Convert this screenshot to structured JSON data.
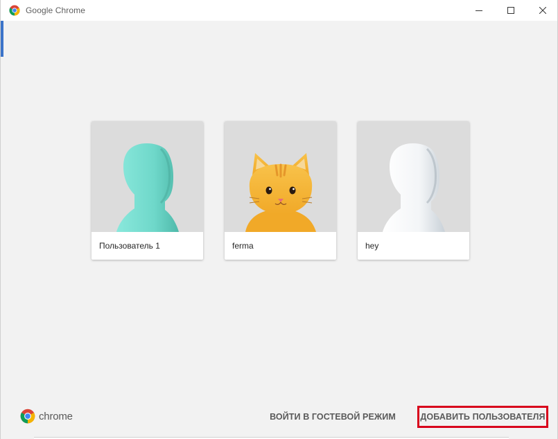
{
  "window": {
    "title": "Google Chrome"
  },
  "profiles": [
    {
      "name": "Пользователь 1",
      "avatar": "teal-silhouette"
    },
    {
      "name": "ferma",
      "avatar": "orange-cat"
    },
    {
      "name": "hey",
      "avatar": "white-silhouette"
    }
  ],
  "footer": {
    "brand": "chrome",
    "guest_label": "ВОЙТИ В ГОСТЕВОЙ РЕЖИМ",
    "add_user_label": "ДОБАВИТЬ ПОЛЬЗОВАТЕЛЯ"
  },
  "colors": {
    "highlight": "#d8001b",
    "teal_avatar": "#74dccf",
    "cat_orange": "#f4b63a",
    "chrome_red": "#db4437",
    "chrome_green": "#0f9d58",
    "chrome_yellow": "#f4b400",
    "chrome_blue": "#4285f4"
  }
}
